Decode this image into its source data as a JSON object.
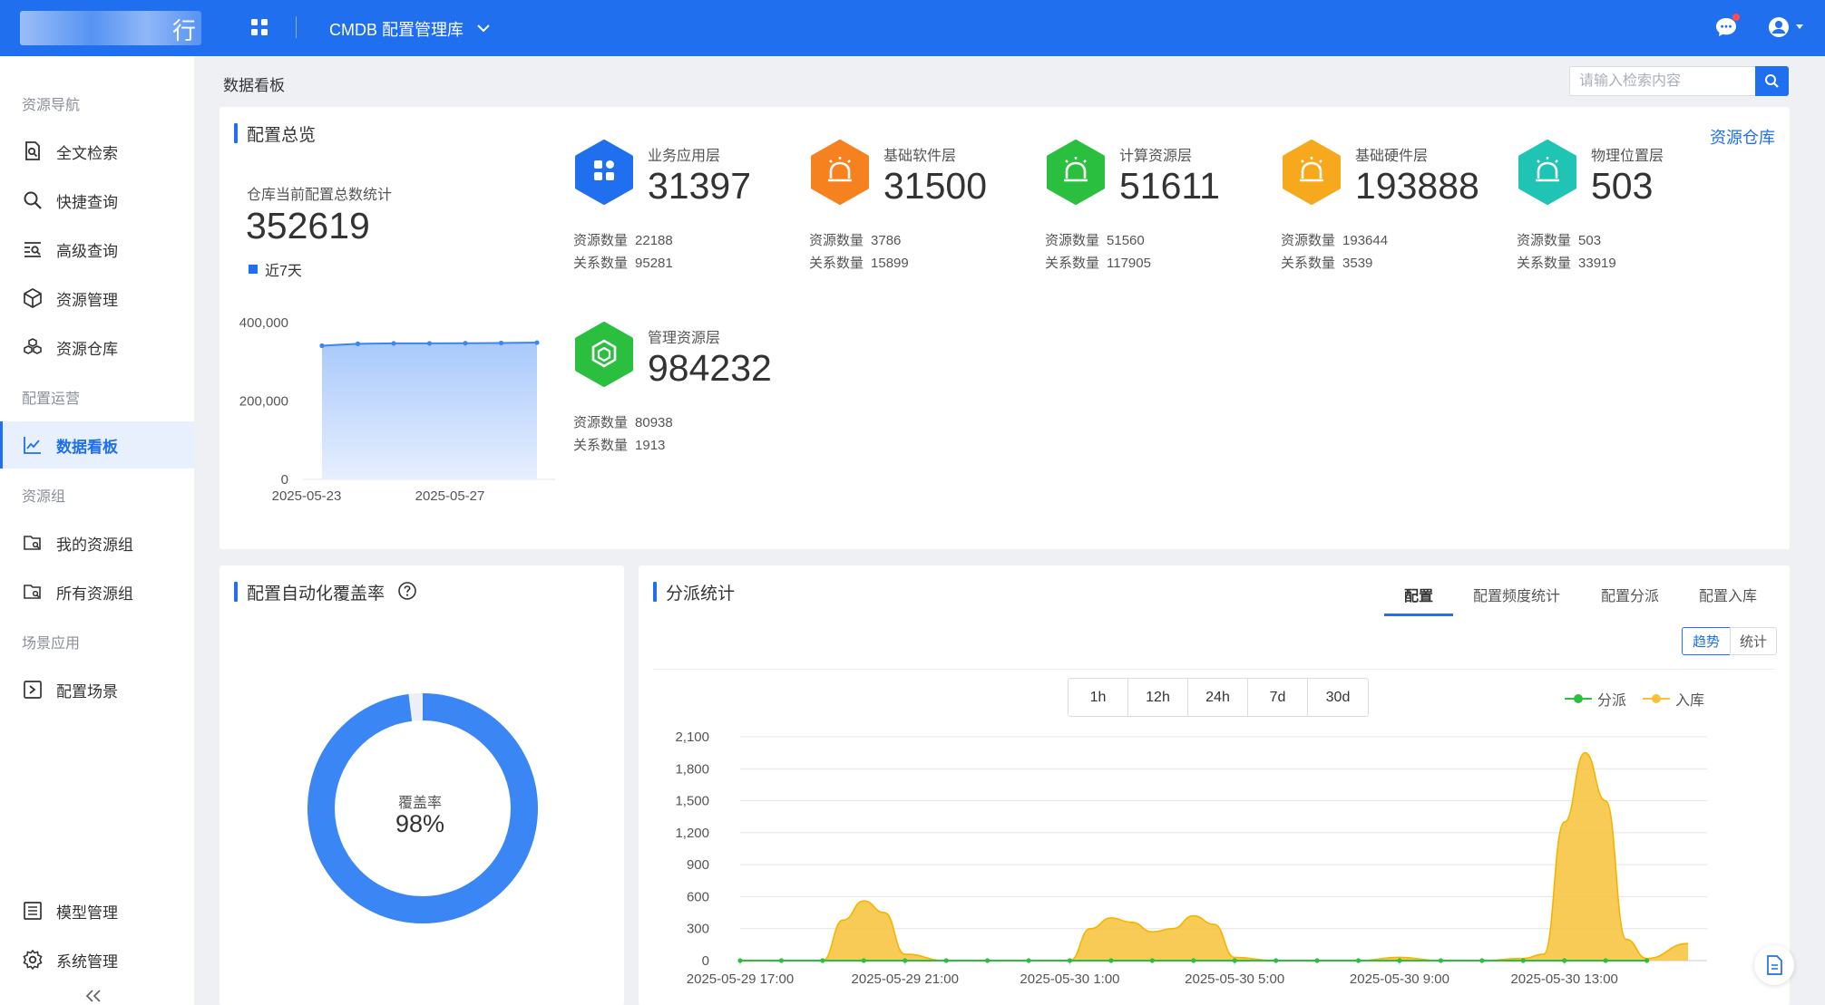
{
  "header": {
    "logo_char": "行",
    "module_title": "CMDB 配置管理库"
  },
  "sidebar": {
    "sections": [
      {
        "title": "资源导航",
        "items": [
          {
            "label": "全文检索",
            "icon": "doc-search-icon"
          },
          {
            "label": "快捷查询",
            "icon": "search-icon"
          },
          {
            "label": "高级查询",
            "icon": "list-search-icon"
          },
          {
            "label": "资源管理",
            "icon": "cube-icon"
          },
          {
            "label": "资源仓库",
            "icon": "boxes-icon"
          }
        ]
      },
      {
        "title": "配置运营",
        "items": [
          {
            "label": "数据看板",
            "icon": "line-chart-icon",
            "active": true
          }
        ]
      },
      {
        "title": "资源组",
        "items": [
          {
            "label": "我的资源组",
            "icon": "folder-icon"
          },
          {
            "label": "所有资源组",
            "icon": "folder-icon"
          }
        ]
      },
      {
        "title": "场景应用",
        "items": [
          {
            "label": "配置场景",
            "icon": "play-box-icon"
          }
        ]
      }
    ],
    "bottom_items": [
      {
        "label": "模型管理",
        "icon": "model-icon"
      },
      {
        "label": "系统管理",
        "icon": "gear-icon"
      }
    ]
  },
  "page": {
    "title": "数据看板",
    "search_placeholder": "请输入检索内容"
  },
  "overview": {
    "title": "配置总览",
    "link": "资源仓库",
    "total_label": "仓库当前配置总数统计",
    "total_value": "352619",
    "legend": "近7天",
    "resource_label": "资源数量",
    "relation_label": "关系数量",
    "layers": [
      {
        "name": "业务应用层",
        "value": "31397",
        "resources": "22188",
        "relations": "95281",
        "color": "#1f6fef",
        "icon": "grid-icon"
      },
      {
        "name": "基础软件层",
        "value": "31500",
        "resources": "3786",
        "relations": "15899",
        "color": "#f5821f",
        "icon": "alarm-icon"
      },
      {
        "name": "计算资源层",
        "value": "51611",
        "resources": "51560",
        "relations": "117905",
        "color": "#2bbf40",
        "icon": "alarm-icon"
      },
      {
        "name": "基础硬件层",
        "value": "193888",
        "resources": "193644",
        "relations": "3539",
        "color": "#f7a91d",
        "icon": "alarm-icon"
      },
      {
        "name": "物理位置层",
        "value": "503",
        "resources": "503",
        "relations": "33919",
        "color": "#1fc4b5",
        "icon": "alarm-icon"
      },
      {
        "name": "管理资源层",
        "value": "984232",
        "resources": "80938",
        "relations": "1913",
        "color": "#2bbf40",
        "icon": "shield-icon"
      }
    ]
  },
  "coverage": {
    "title": "配置自动化覆盖率",
    "label": "覆盖率",
    "value_text": "98%",
    "fraction": 0.98
  },
  "dispatch": {
    "title": "分派统计",
    "tabs": [
      "配置",
      "配置频度统计",
      "配置分派",
      "配置入库"
    ],
    "active_tab": 0,
    "toggles": [
      "趋势",
      "统计"
    ],
    "ranges": [
      "1h",
      "12h",
      "24h",
      "7d",
      "30d"
    ]
  },
  "colors": {
    "primary": "#1f6fef",
    "dispatch": "#2bbf40",
    "ingest": "#f7c23a"
  },
  "chart_data": [
    {
      "type": "area",
      "legend": [
        "近7天"
      ],
      "x": [
        "2025-05-23",
        "2025-05-24",
        "2025-05-25",
        "2025-05-26",
        "2025-05-27",
        "2025-05-28",
        "2025-05-29"
      ],
      "xtick_labels": [
        "2025-05-23",
        "2025-05-27"
      ],
      "series": [
        {
          "name": "近7天",
          "values": [
            341000,
            346000,
            347000,
            347000,
            347500,
            348000,
            349000
          ]
        }
      ],
      "ylim": [
        0,
        400000
      ],
      "yticks": [
        "400,000",
        "200,000",
        "0"
      ],
      "ytick_values": [
        400000,
        200000,
        0
      ]
    },
    {
      "type": "line",
      "x_labels": [
        "2025-05-29 17:00",
        "2025-05-29 21:00",
        "2025-05-30 1:00",
        "2025-05-30 5:00",
        "2025-05-30 9:00",
        "2025-05-30 13:00"
      ],
      "x_range_hours": [
        17,
        40
      ],
      "series": [
        {
          "name": "分派",
          "points": [
            [
              17,
              0
            ],
            [
              18,
              0
            ],
            [
              19,
              0
            ],
            [
              20,
              0
            ],
            [
              21,
              0
            ],
            [
              22,
              0
            ],
            [
              23,
              0
            ],
            [
              24,
              0
            ],
            [
              25,
              0
            ],
            [
              26,
              0
            ],
            [
              27,
              0
            ],
            [
              28,
              0
            ],
            [
              29,
              0
            ],
            [
              30,
              0
            ],
            [
              31,
              0
            ],
            [
              32,
              0
            ],
            [
              33,
              0
            ],
            [
              34,
              0
            ],
            [
              35,
              0
            ],
            [
              36,
              0
            ],
            [
              37,
              0
            ],
            [
              38,
              0
            ],
            [
              39,
              0
            ]
          ]
        },
        {
          "name": "入库",
          "points": [
            [
              17,
              0
            ],
            [
              18,
              0
            ],
            [
              19,
              0
            ],
            [
              19.5,
              380
            ],
            [
              20,
              560
            ],
            [
              20.5,
              450
            ],
            [
              21,
              60
            ],
            [
              22,
              0
            ],
            [
              23,
              0
            ],
            [
              24,
              0
            ],
            [
              25,
              0
            ],
            [
              25.5,
              300
            ],
            [
              26,
              400
            ],
            [
              26.5,
              360
            ],
            [
              27,
              270
            ],
            [
              27.5,
              300
            ],
            [
              28,
              420
            ],
            [
              28.5,
              340
            ],
            [
              29,
              30
            ],
            [
              30,
              0
            ],
            [
              31,
              0
            ],
            [
              32,
              0
            ],
            [
              33,
              30
            ],
            [
              34,
              0
            ],
            [
              35,
              0
            ],
            [
              36,
              20
            ],
            [
              36.5,
              60
            ],
            [
              37,
              1300
            ],
            [
              37.5,
              1950
            ],
            [
              38,
              1500
            ],
            [
              38.5,
              200
            ],
            [
              39,
              20
            ],
            [
              40,
              160
            ]
          ]
        }
      ],
      "ylim": [
        0,
        2100
      ],
      "yticks": [
        "2,100",
        "1,800",
        "1,500",
        "1,200",
        "900",
        "600",
        "300",
        "0"
      ]
    }
  ]
}
